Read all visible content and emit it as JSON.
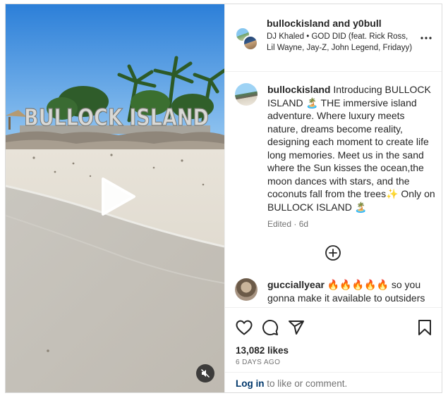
{
  "header": {
    "owner": "bullockisland",
    "and": "and",
    "collaborator": "y0bull",
    "audio": "DJ Khaled • GOD DID (feat. Rick Ross, Lil Wayne, Jay-Z, John Legend, Fridayy)"
  },
  "media": {
    "sign_text": "BULLOCK ISLAND"
  },
  "caption": {
    "username": "bullockisland",
    "text": "Introducing BULLOCK ISLAND 🏝️ THE immersive island adventure. Where luxury meets nature, dreams become reality, designing each moment to create life long memories. Meet us in the sand where the Sun kisses the ocean,the moon dances with stars, and the coconuts fall from the trees✨ Only on BULLOCK ISLAND 🏝️",
    "meta": "Edited · 6d"
  },
  "comment": {
    "username": "gucciallyear",
    "text": "🔥🔥🔥🔥🔥 so you gonna make it available to outsiders as well or just family & friends??"
  },
  "stats": {
    "likes": "13,082 likes",
    "date": "6 DAYS AGO"
  },
  "login": {
    "link": "Log in",
    "rest": "to like or comment."
  },
  "icons": {
    "play": "play-icon",
    "mute": "muted-speaker-icon",
    "more": "more-horizontal-icon",
    "add": "add-circle-icon",
    "like": "heart-icon",
    "comment": "comment-bubble-icon",
    "share": "paper-plane-icon",
    "save": "bookmark-icon"
  },
  "colors": {
    "link": "#00376b",
    "muted_text": "#737373",
    "border": "#dbdbdb"
  }
}
